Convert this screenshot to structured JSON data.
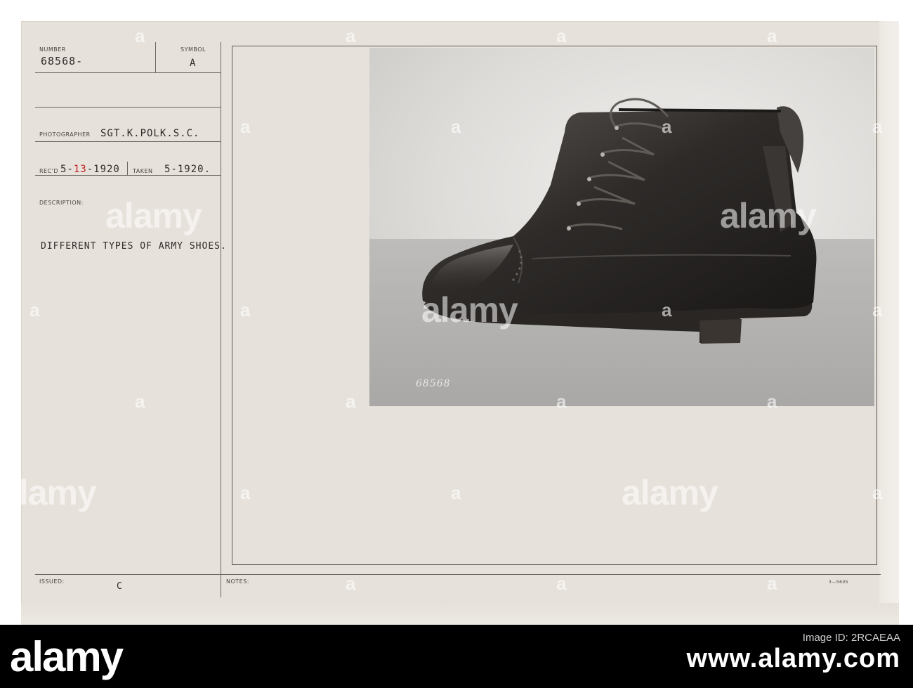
{
  "record": {
    "number_label": "NUMBER",
    "number": "68568-",
    "symbol_label": "SYMBOL",
    "symbol": "A",
    "photographer_label": "PHOTOGRAPHER",
    "photographer": "SGT.K.POLK.S.C.",
    "recd_label": "REC'D",
    "recd_pre": "5-",
    "recd_red": "13",
    "recd_post": "-1920",
    "taken_label": "TAKEN",
    "taken": "5-1920.",
    "description_label": "DESCRIPTION:",
    "description": "DIFFERENT TYPES OF ARMY SHOES.",
    "issued_label": "ISSUED:",
    "issued": "C",
    "notes_label": "NOTES:",
    "form_code": "3—5605"
  },
  "photo": {
    "caption_number": "68568",
    "subject": "leather army boot"
  },
  "watermark": {
    "text": "alamy",
    "mark": "a"
  },
  "stock_bar": {
    "logo": "alamy",
    "line1": "Image ID: 2RCAEAA",
    "line2": "www.alamy.com"
  }
}
